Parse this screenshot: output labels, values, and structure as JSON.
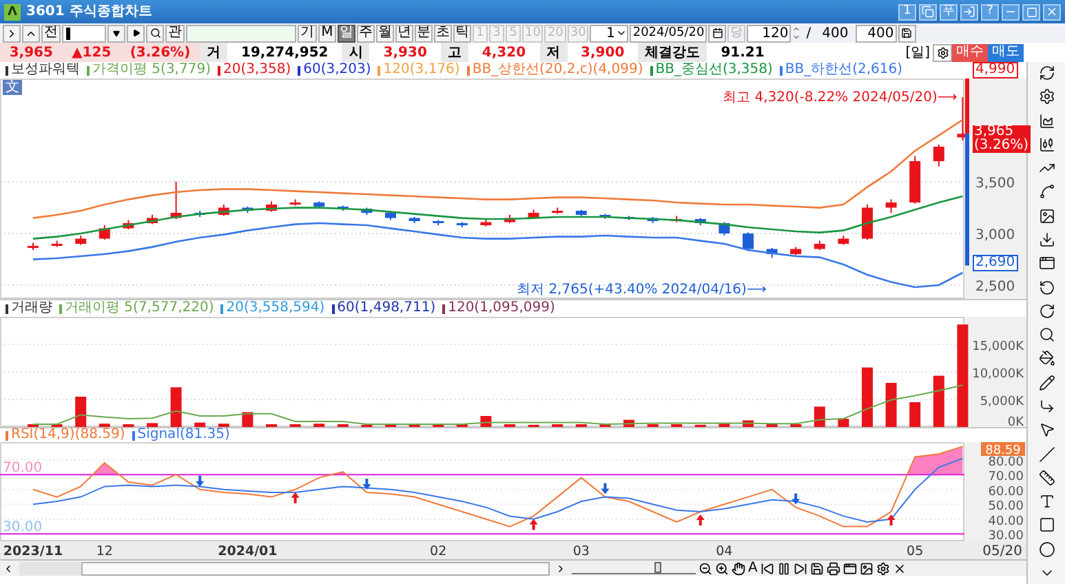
{
  "window": {
    "logo": "Λ",
    "title": "3601 주식종합차트",
    "text_buttons": [
      "1",
      "푸",
      "?"
    ]
  },
  "toolbar": {
    "prev_label": "전",
    "search_label": "관",
    "chart_labels": [
      "기",
      "M"
    ],
    "periods": [
      {
        "label": "일",
        "selected": true
      },
      {
        "label": "주",
        "selected": false
      },
      {
        "label": "월",
        "selected": false
      },
      {
        "label": "년",
        "selected": false
      },
      {
        "label": "분",
        "selected": false
      },
      {
        "label": "초",
        "selected": false
      },
      {
        "label": "틱",
        "selected": false
      }
    ],
    "intervals": [
      {
        "label": "1",
        "disabled": true
      },
      {
        "label": "3",
        "disabled": true
      },
      {
        "label": "5",
        "disabled": true
      },
      {
        "label": "10",
        "disabled": true
      },
      {
        "label": "20",
        "disabled": true
      },
      {
        "label": "30",
        "disabled": true
      }
    ],
    "interval_value": "1",
    "date": "2024/05/20",
    "today": {
      "label": "당",
      "disabled": true
    },
    "count": "120",
    "slash": "/",
    "total": "400",
    "display_count": "400"
  },
  "quote": {
    "price": "3,965",
    "change": "▲125",
    "rate": "(3.26%)",
    "stats": [
      {
        "label": "거",
        "value": "19,274,952",
        "color": "#000000"
      },
      {
        "label": "시",
        "value": "3,930",
        "color": "#e8141b"
      },
      {
        "label": "고",
        "value": "4,320",
        "color": "#e8141b"
      },
      {
        "label": "저",
        "value": "3,900",
        "color": "#e8141b"
      },
      {
        "label": "체결강도",
        "value": "91.21",
        "color": "#000000"
      }
    ],
    "period_label": "[일]",
    "buy": "매수",
    "sell": "매도"
  },
  "price_panel": {
    "legend": [
      {
        "label": "보성파워텍",
        "color": "#333333"
      },
      {
        "label": "가격이평 5(3,779)",
        "color": "#6aa84f"
      },
      {
        "label": "20(3,358)",
        "color": "#e8141b"
      },
      {
        "label": "60(3,203)",
        "color": "#2233cc"
      },
      {
        "label": "120(3,176)",
        "color": "#f0a040"
      }
    ],
    "badge": "文",
    "upper_limit": "4,990",
    "lower_limit": "2,690",
    "last_price": "3,965",
    "last_rate": "(3.26%)",
    "high_note": "최고 4,320(-8.22% 2024/05/20)⟶",
    "low_note": "최저 2,765(+43.40% 2024/04/16)⟶",
    "chart_data": {
      "type": "candlestick",
      "grid": true,
      "ylim": [
        2367,
        4500
      ],
      "yticks": [
        {
          "value": 2500,
          "label": "2,500"
        },
        {
          "value": 3000,
          "label": "3,000"
        },
        {
          "value": 3500,
          "label": "3,500"
        }
      ],
      "categories": [
        null,
        null,
        null,
        null,
        null,
        null,
        null,
        null,
        null,
        null,
        null,
        null,
        null,
        null,
        null,
        null,
        null,
        null,
        null,
        null,
        null,
        null,
        null,
        null,
        null,
        null,
        null,
        null,
        null,
        null,
        null,
        null,
        null,
        null,
        null,
        null,
        null,
        null,
        null,
        null
      ],
      "ohlc": [
        [
          2860,
          2910,
          2840,
          2880
        ],
        [
          2880,
          2930,
          2870,
          2900
        ],
        [
          2900,
          2980,
          2890,
          2950
        ],
        [
          2950,
          3080,
          2940,
          3050
        ],
        [
          3050,
          3130,
          3040,
          3100
        ],
        [
          3100,
          3180,
          3090,
          3150
        ],
        [
          3150,
          3500,
          3140,
          3200
        ],
        [
          3200,
          3220,
          3160,
          3180
        ],
        [
          3180,
          3280,
          3170,
          3250
        ],
        [
          3250,
          3260,
          3200,
          3220
        ],
        [
          3220,
          3310,
          3210,
          3280
        ],
        [
          3280,
          3330,
          3270,
          3300
        ],
        [
          3300,
          3310,
          3240,
          3260
        ],
        [
          3260,
          3270,
          3220,
          3240
        ],
        [
          3240,
          3250,
          3180,
          3200
        ],
        [
          3200,
          3210,
          3130,
          3150
        ],
        [
          3150,
          3160,
          3100,
          3120
        ],
        [
          3120,
          3130,
          3080,
          3100
        ],
        [
          3100,
          3110,
          3060,
          3080
        ],
        [
          3080,
          3140,
          3070,
          3110
        ],
        [
          3110,
          3180,
          3100,
          3150
        ],
        [
          3150,
          3230,
          3140,
          3200
        ],
        [
          3200,
          3250,
          3190,
          3220
        ],
        [
          3220,
          3230,
          3160,
          3180
        ],
        [
          3180,
          3190,
          3140,
          3160
        ],
        [
          3160,
          3170,
          3130,
          3150
        ],
        [
          3150,
          3160,
          3100,
          3120
        ],
        [
          3120,
          3170,
          3110,
          3140
        ],
        [
          3140,
          3150,
          3080,
          3100
        ],
        [
          3100,
          3110,
          2980,
          3000
        ],
        [
          3000,
          3010,
          2830,
          2850
        ],
        [
          2850,
          2860,
          2765,
          2800
        ],
        [
          2800,
          2870,
          2790,
          2850
        ],
        [
          2850,
          2930,
          2840,
          2900
        ],
        [
          2900,
          2980,
          2890,
          2950
        ],
        [
          2950,
          3280,
          2940,
          3250
        ],
        [
          3250,
          3330,
          3200,
          3300
        ],
        [
          3300,
          3750,
          3290,
          3700
        ],
        [
          3700,
          3860,
          3650,
          3840
        ],
        [
          3930,
          4320,
          3900,
          3965
        ]
      ],
      "series": [
        {
          "name": "BB_상한선(20,2,c)(4,099)",
          "type": "line",
          "color": "#f07a3a",
          "values": [
            3150,
            3180,
            3220,
            3280,
            3330,
            3370,
            3400,
            3420,
            3430,
            3430,
            3420,
            3410,
            3400,
            3390,
            3380,
            3370,
            3360,
            3350,
            3340,
            3330,
            3330,
            3340,
            3350,
            3350,
            3340,
            3330,
            3320,
            3300,
            3290,
            3280,
            3280,
            3270,
            3260,
            3250,
            3280,
            3450,
            3600,
            3800,
            3950,
            4100
          ]
        },
        {
          "name": "BB_중심선(3,358)",
          "type": "line",
          "color": "#1a9641",
          "values": [
            2950,
            2970,
            3000,
            3040,
            3080,
            3120,
            3160,
            3190,
            3210,
            3230,
            3240,
            3250,
            3250,
            3240,
            3230,
            3210,
            3190,
            3170,
            3150,
            3140,
            3140,
            3150,
            3160,
            3160,
            3160,
            3150,
            3140,
            3130,
            3110,
            3090,
            3060,
            3040,
            3020,
            3010,
            3030,
            3100,
            3160,
            3230,
            3300,
            3360
          ]
        },
        {
          "name": "BB_하한선(2,616)",
          "type": "line",
          "color": "#3a78e8",
          "values": [
            2750,
            2760,
            2780,
            2800,
            2830,
            2870,
            2920,
            2960,
            2990,
            3030,
            3060,
            3090,
            3100,
            3090,
            3080,
            3050,
            3020,
            2990,
            2960,
            2950,
            2950,
            2960,
            2970,
            2970,
            2980,
            2970,
            2960,
            2960,
            2930,
            2900,
            2840,
            2810,
            2780,
            2770,
            2700,
            2600,
            2530,
            2480,
            2500,
            2620
          ]
        }
      ]
    }
  },
  "volume_panel": {
    "legend": [
      {
        "label": "20(3,558,594)",
        "color": "#3399dd"
      },
      {
        "label": "60(1,498,711)",
        "color": "#2233aa"
      },
      {
        "label": "120(1,095,099)",
        "color": "#883355"
      }
    ],
    "chart_data": {
      "type": "bar",
      "grid": true,
      "ylim": [
        0,
        20000
      ],
      "yticks": [
        {
          "value": 0,
          "label": "0K"
        },
        {
          "value": 5000,
          "label": "5,000K"
        },
        {
          "value": 10000,
          "label": "10,000K"
        },
        {
          "value": 15000,
          "label": "15,000K"
        }
      ],
      "categories": [
        null,
        null,
        null,
        null,
        null,
        null,
        null,
        null,
        null,
        null,
        null,
        null,
        null,
        null,
        null,
        null,
        null,
        null,
        null,
        null,
        null,
        null,
        null,
        null,
        null,
        null,
        null,
        null,
        null,
        null,
        null,
        null,
        null,
        null,
        null,
        null,
        null,
        null,
        null,
        null
      ],
      "series": [
        {
          "name": "거래량",
          "color": "#e8141b",
          "values": [
            500,
            500,
            5500,
            600,
            500,
            700,
            7200,
            800,
            600,
            2700,
            500,
            500,
            600,
            500,
            400,
            500,
            500,
            400,
            500,
            2000,
            500,
            400,
            500,
            500,
            500,
            1300,
            500,
            500,
            400,
            600,
            1200,
            500,
            500,
            3700,
            1500,
            10800,
            8000,
            4500,
            9300,
            18600
          ]
        },
        {
          "name": "거래이평 5(7,577,220)",
          "type": "line",
          "color": "#6aa84f",
          "values": [
            500,
            500,
            2200,
            1800,
            1500,
            1600,
            2900,
            2000,
            2000,
            2400,
            2400,
            1000,
            1000,
            1000,
            500,
            500,
            500,
            500,
            500,
            800,
            800,
            800,
            800,
            800,
            500,
            600,
            700,
            700,
            700,
            700,
            700,
            600,
            600,
            1300,
            1500,
            3300,
            4900,
            5700,
            6600,
            7600
          ]
        }
      ]
    }
  },
  "rsi_panel": {
    "upper_label": "70.00",
    "lower_label": "30.00",
    "last_value": "88.59",
    "last_date": "05/20",
    "chart_data": {
      "type": "line",
      "grid": true,
      "ylim": [
        25,
        92
      ],
      "categories": [
        "2023/11",
        null,
        null,
        "12",
        null,
        null,
        null,
        null,
        null,
        "2024/01",
        null,
        null,
        null,
        null,
        null,
        null,
        null,
        "02",
        null,
        null,
        null,
        null,
        null,
        "03",
        null,
        null,
        null,
        null,
        null,
        "04",
        null,
        null,
        null,
        null,
        null,
        null,
        null,
        "05",
        null,
        null
      ],
      "yticks": [
        {
          "value": 30,
          "label": "30.00"
        },
        {
          "value": 40,
          "label": "40.00"
        },
        {
          "value": 50,
          "label": "50.00"
        },
        {
          "value": 60,
          "label": "60.00"
        },
        {
          "value": 70,
          "label": "70.00"
        },
        {
          "value": 80,
          "label": "80.00"
        }
      ],
      "series": [
        {
          "name": "RSI(14,9)(88.59)",
          "color": "#f07a3a",
          "values": [
            60,
            55,
            62,
            78,
            65,
            63,
            70,
            60,
            58,
            57,
            55,
            60,
            68,
            72,
            58,
            57,
            55,
            50,
            45,
            40,
            35,
            42,
            55,
            68,
            55,
            52,
            45,
            38,
            45,
            50,
            55,
            60,
            48,
            42,
            35,
            35,
            45,
            82,
            84,
            89
          ]
        },
        {
          "name": "Signal(81.35)",
          "color": "#3a78e8",
          "values": [
            50,
            52,
            55,
            62,
            63,
            62,
            63,
            62,
            60,
            59,
            58,
            58,
            60,
            62,
            61,
            60,
            58,
            55,
            52,
            48,
            42,
            40,
            45,
            52,
            55,
            54,
            50,
            46,
            45,
            47,
            50,
            53,
            52,
            48,
            42,
            38,
            40,
            60,
            75,
            81
          ]
        }
      ]
    }
  },
  "bottom_bar": {
    "text_tool": "A",
    "zoom": {
      "level": 0.7
    }
  }
}
